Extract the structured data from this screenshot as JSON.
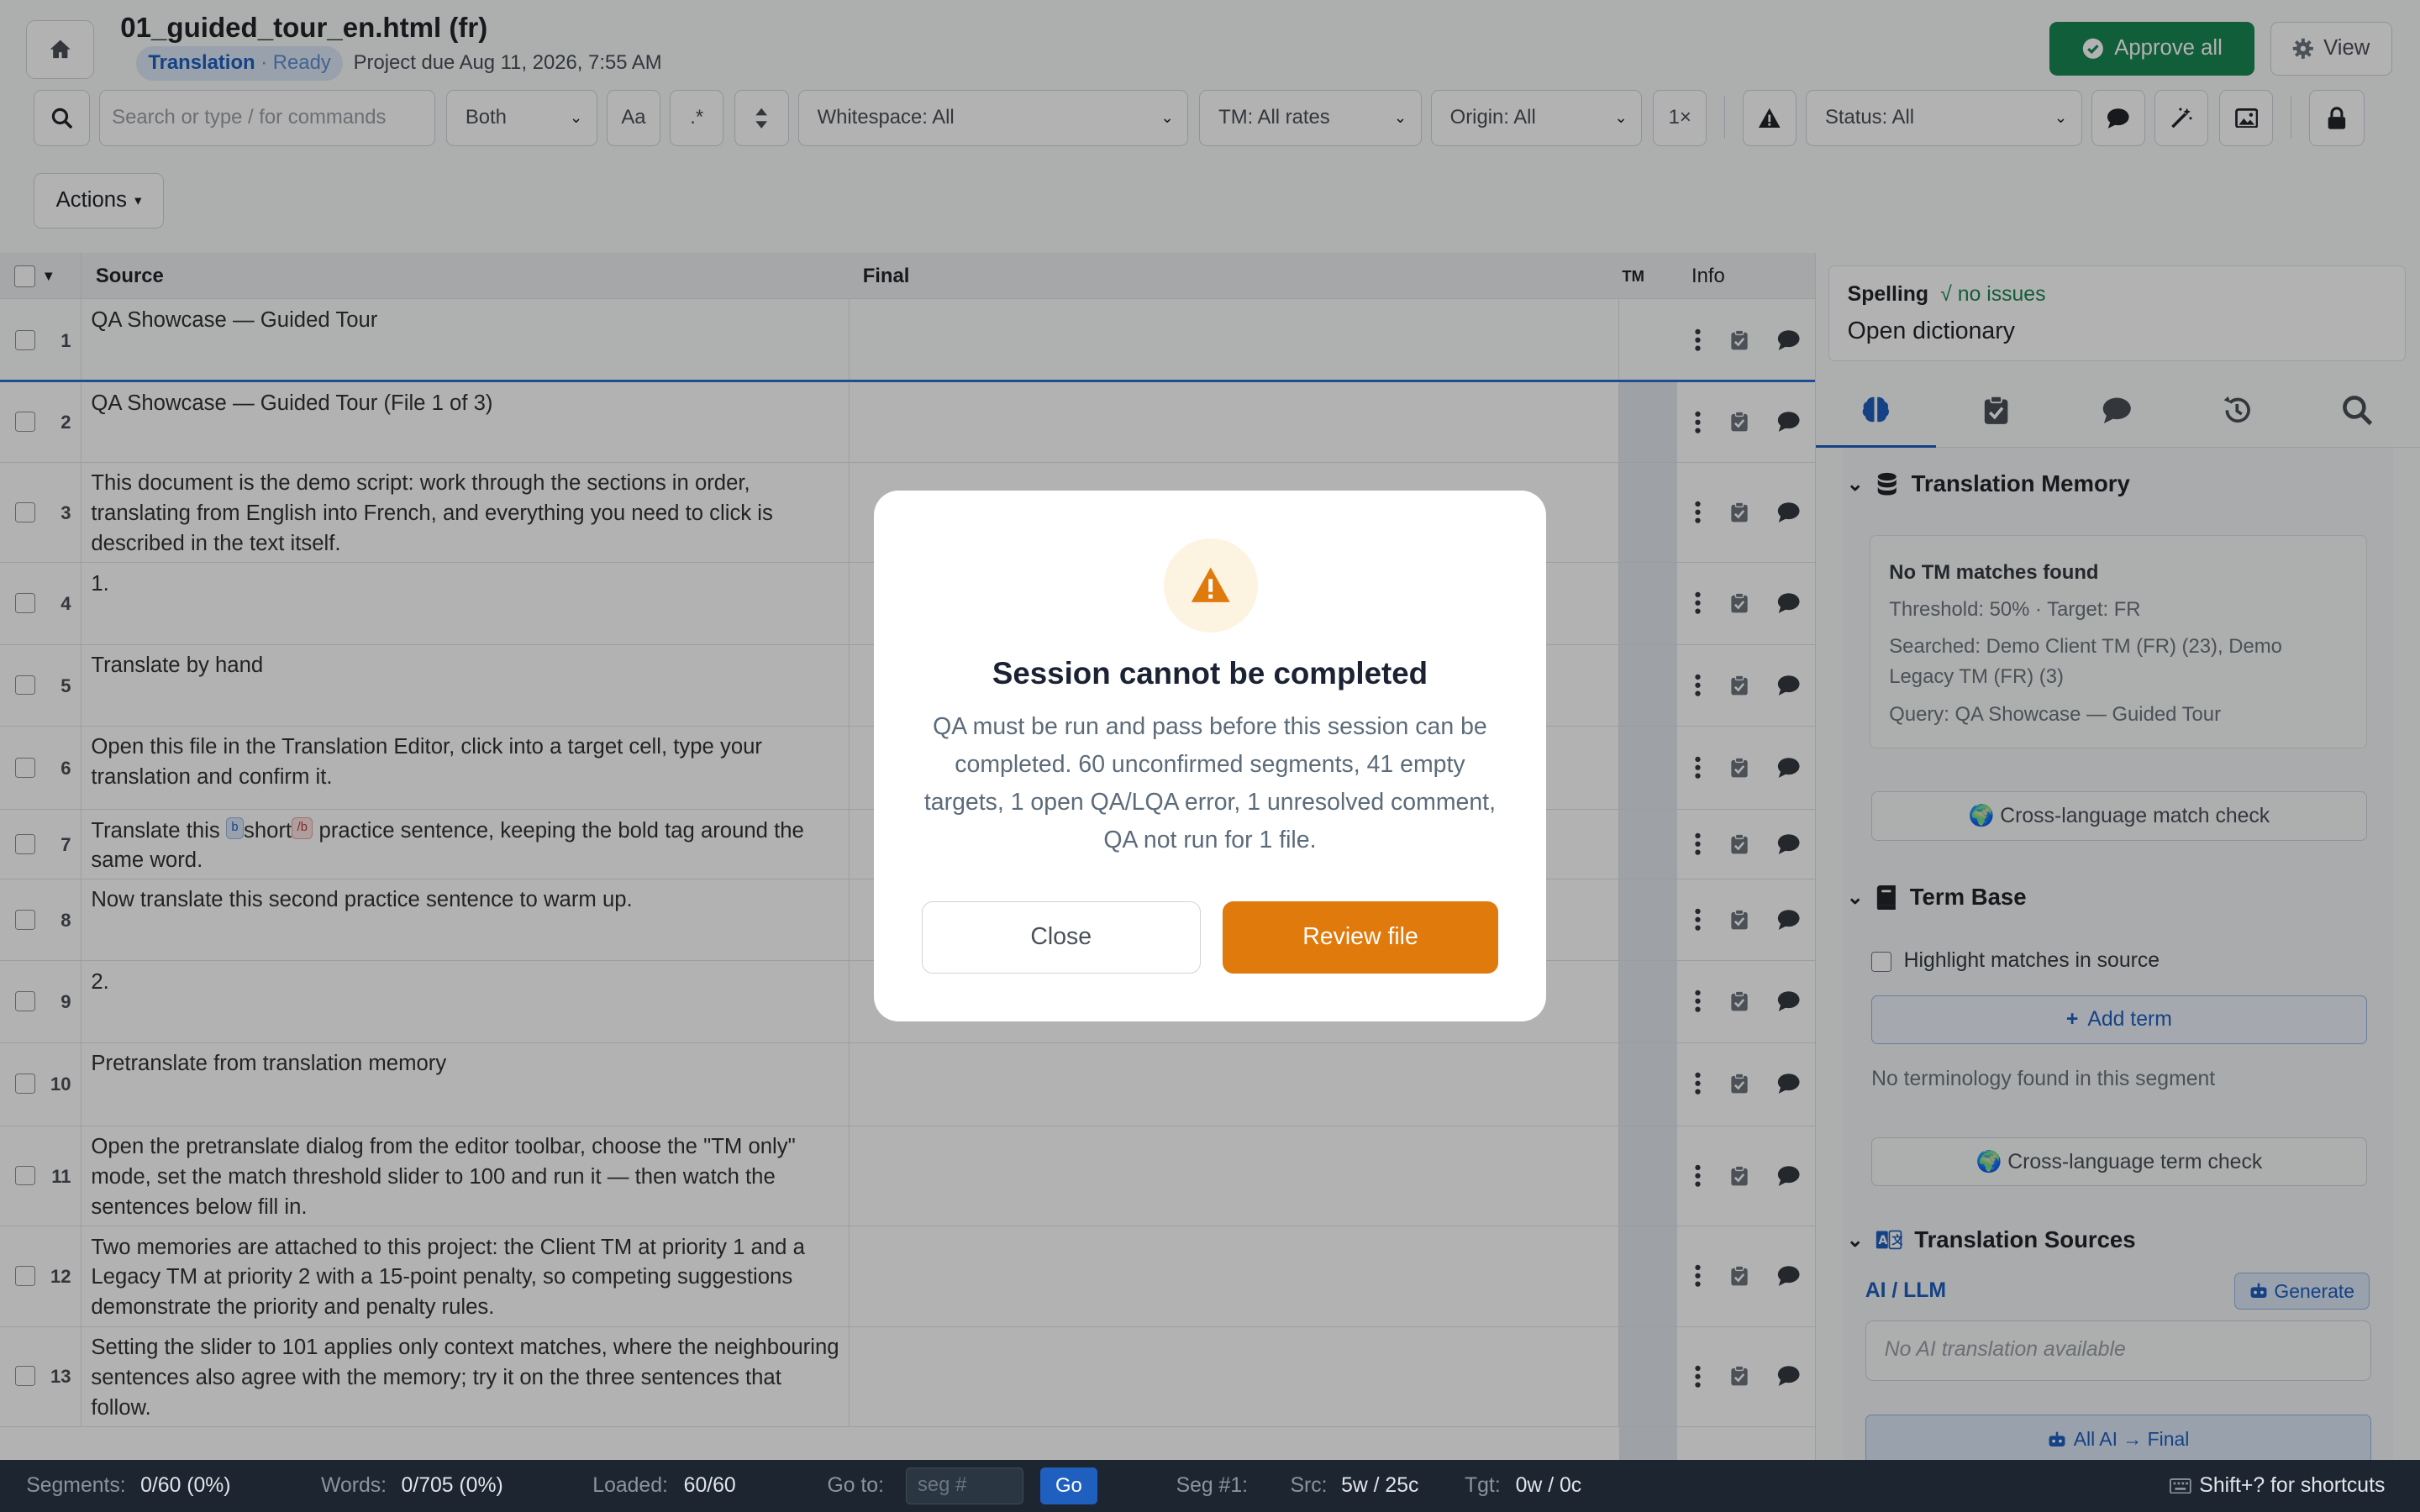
{
  "header": {
    "file_title": "01_guided_tour_en.html (fr)",
    "stage": "Translation",
    "stage_status": "· Ready",
    "due": "Project due Aug 11, 2026, 7:55 AM",
    "approve_label": "Approve all",
    "view_label": "View",
    "home_icon": "home-icon"
  },
  "toolbar": {
    "search_placeholder": "Search or type / for commands",
    "scope": "Both",
    "case_label": "Aa",
    "regex_label": ".*",
    "whitespace": "Whitespace: All",
    "tm": "TM: All rates",
    "origin": "Origin: All",
    "multiplier": "1×",
    "status": "Status: All",
    "actions_label": "Actions",
    "actions_caret": "▾"
  },
  "grid": {
    "headers": {
      "source": "Source",
      "final": "Final",
      "tm": "TM",
      "info": "Info"
    },
    "rows": [
      {
        "num": "1",
        "src": "QA Showcase — Guided Tour"
      },
      {
        "num": "2",
        "src": "QA Showcase — Guided Tour (File 1 of 3)"
      },
      {
        "num": "3",
        "src": "This document is the demo script: work through the sections in order, translating from English into French, and everything you need to click is described in the text itself."
      },
      {
        "num": "4",
        "src": "1."
      },
      {
        "num": "5",
        "src": "Translate by hand"
      },
      {
        "num": "6",
        "src": "Open this file in the Translation Editor, click into a target cell, type your translation and confirm it."
      },
      {
        "num": "7",
        "src_before": "Translate this ",
        "tag_open": "b",
        "src_mid": "short",
        "tag_close": "/b",
        "src_after": " practice sentence, keeping the bold tag around the same word."
      },
      {
        "num": "8",
        "src": "Now translate this second practice sentence to warm up."
      },
      {
        "num": "9",
        "src": "2."
      },
      {
        "num": "10",
        "src": "Pretranslate from translation memory"
      },
      {
        "num": "11",
        "src": "Open the pretranslate dialog from the editor toolbar, choose the \"TM only\" mode, set the match threshold slider to 100 and run it — then watch the sentences below fill in."
      },
      {
        "num": "12",
        "src": "Two memories are attached to this project: the Client TM at priority 1 and a Legacy TM at priority 2 with a 15-point penalty, so competing suggestions demonstrate the priority and penalty rules."
      },
      {
        "num": "13",
        "src": "Setting the slider to 101 applies only context matches, where the neighbouring sentences also agree with the memory; try it on the three sentences that follow."
      }
    ]
  },
  "panel": {
    "spelling_label": "Spelling",
    "spelling_status": "√ no issues",
    "dictionary_link": "Open dictionary",
    "tm_title": "Translation Memory",
    "tm_none": "No TM matches found",
    "tm_threshold": "Threshold: 50% · Target: FR",
    "tm_searched": "Searched: Demo Client TM (FR) (23), Demo Legacy TM (FR) (3)",
    "tm_query": "Query: QA Showcase — Guided Tour",
    "cross_match": "🌍 Cross-language match check",
    "tb_title": "Term Base",
    "highlight_label": "Highlight matches in source",
    "add_term": "Add term",
    "no_term": "No terminology found in this segment",
    "cross_term": "🌍 Cross-language term check",
    "ts_title": "Translation Sources",
    "ai_label": "AI / LLM",
    "generate": "Generate",
    "ai_placeholder": "No AI translation available",
    "all_ai": "All AI → Final"
  },
  "statusbar": {
    "segments_label": "Segments:",
    "segments_value": "0/60 (0%)",
    "words_label": "Words:",
    "words_value": "0/705 (0%)",
    "loaded_label": "Loaded:",
    "loaded_value": "60/60",
    "goto_label": "Go to:",
    "goto_placeholder": "seg #",
    "go_label": "Go",
    "seg_label": "Seg #1:",
    "src_label": "Src:",
    "src_value": "5w / 25c",
    "tgt_label": "Tgt:",
    "tgt_value": "0w / 0c",
    "shortcuts": "Shift+? for shortcuts"
  },
  "modal": {
    "title": "Session cannot be completed",
    "body": "QA must be run and pass before this session can be completed. 60 unconfirmed segments, 41 empty targets, 1 open QA/LQA error, 1 unresolved comment, QA not run for 1 file.",
    "close_label": "Close",
    "review_label": "Review file",
    "icon": "warning-icon"
  },
  "colors": {
    "accent": "#1f5fbf",
    "approve": "#198754",
    "warning": "#e07a0c"
  }
}
